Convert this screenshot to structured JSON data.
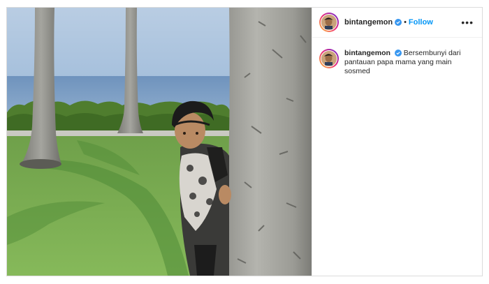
{
  "post": {
    "username": "bintangemon",
    "follow_label": "Follow",
    "separator": "•",
    "more_label": "•••",
    "caption": "Bersembunyi dari pantauan papa mama yang main sosmed"
  },
  "colors": {
    "link_blue": "#0095f6",
    "verified_blue": "#3897f0",
    "text": "#262626",
    "border": "#dbdbdb"
  },
  "icons": {
    "verified": "verified-badge-icon",
    "more": "more-options-icon"
  }
}
